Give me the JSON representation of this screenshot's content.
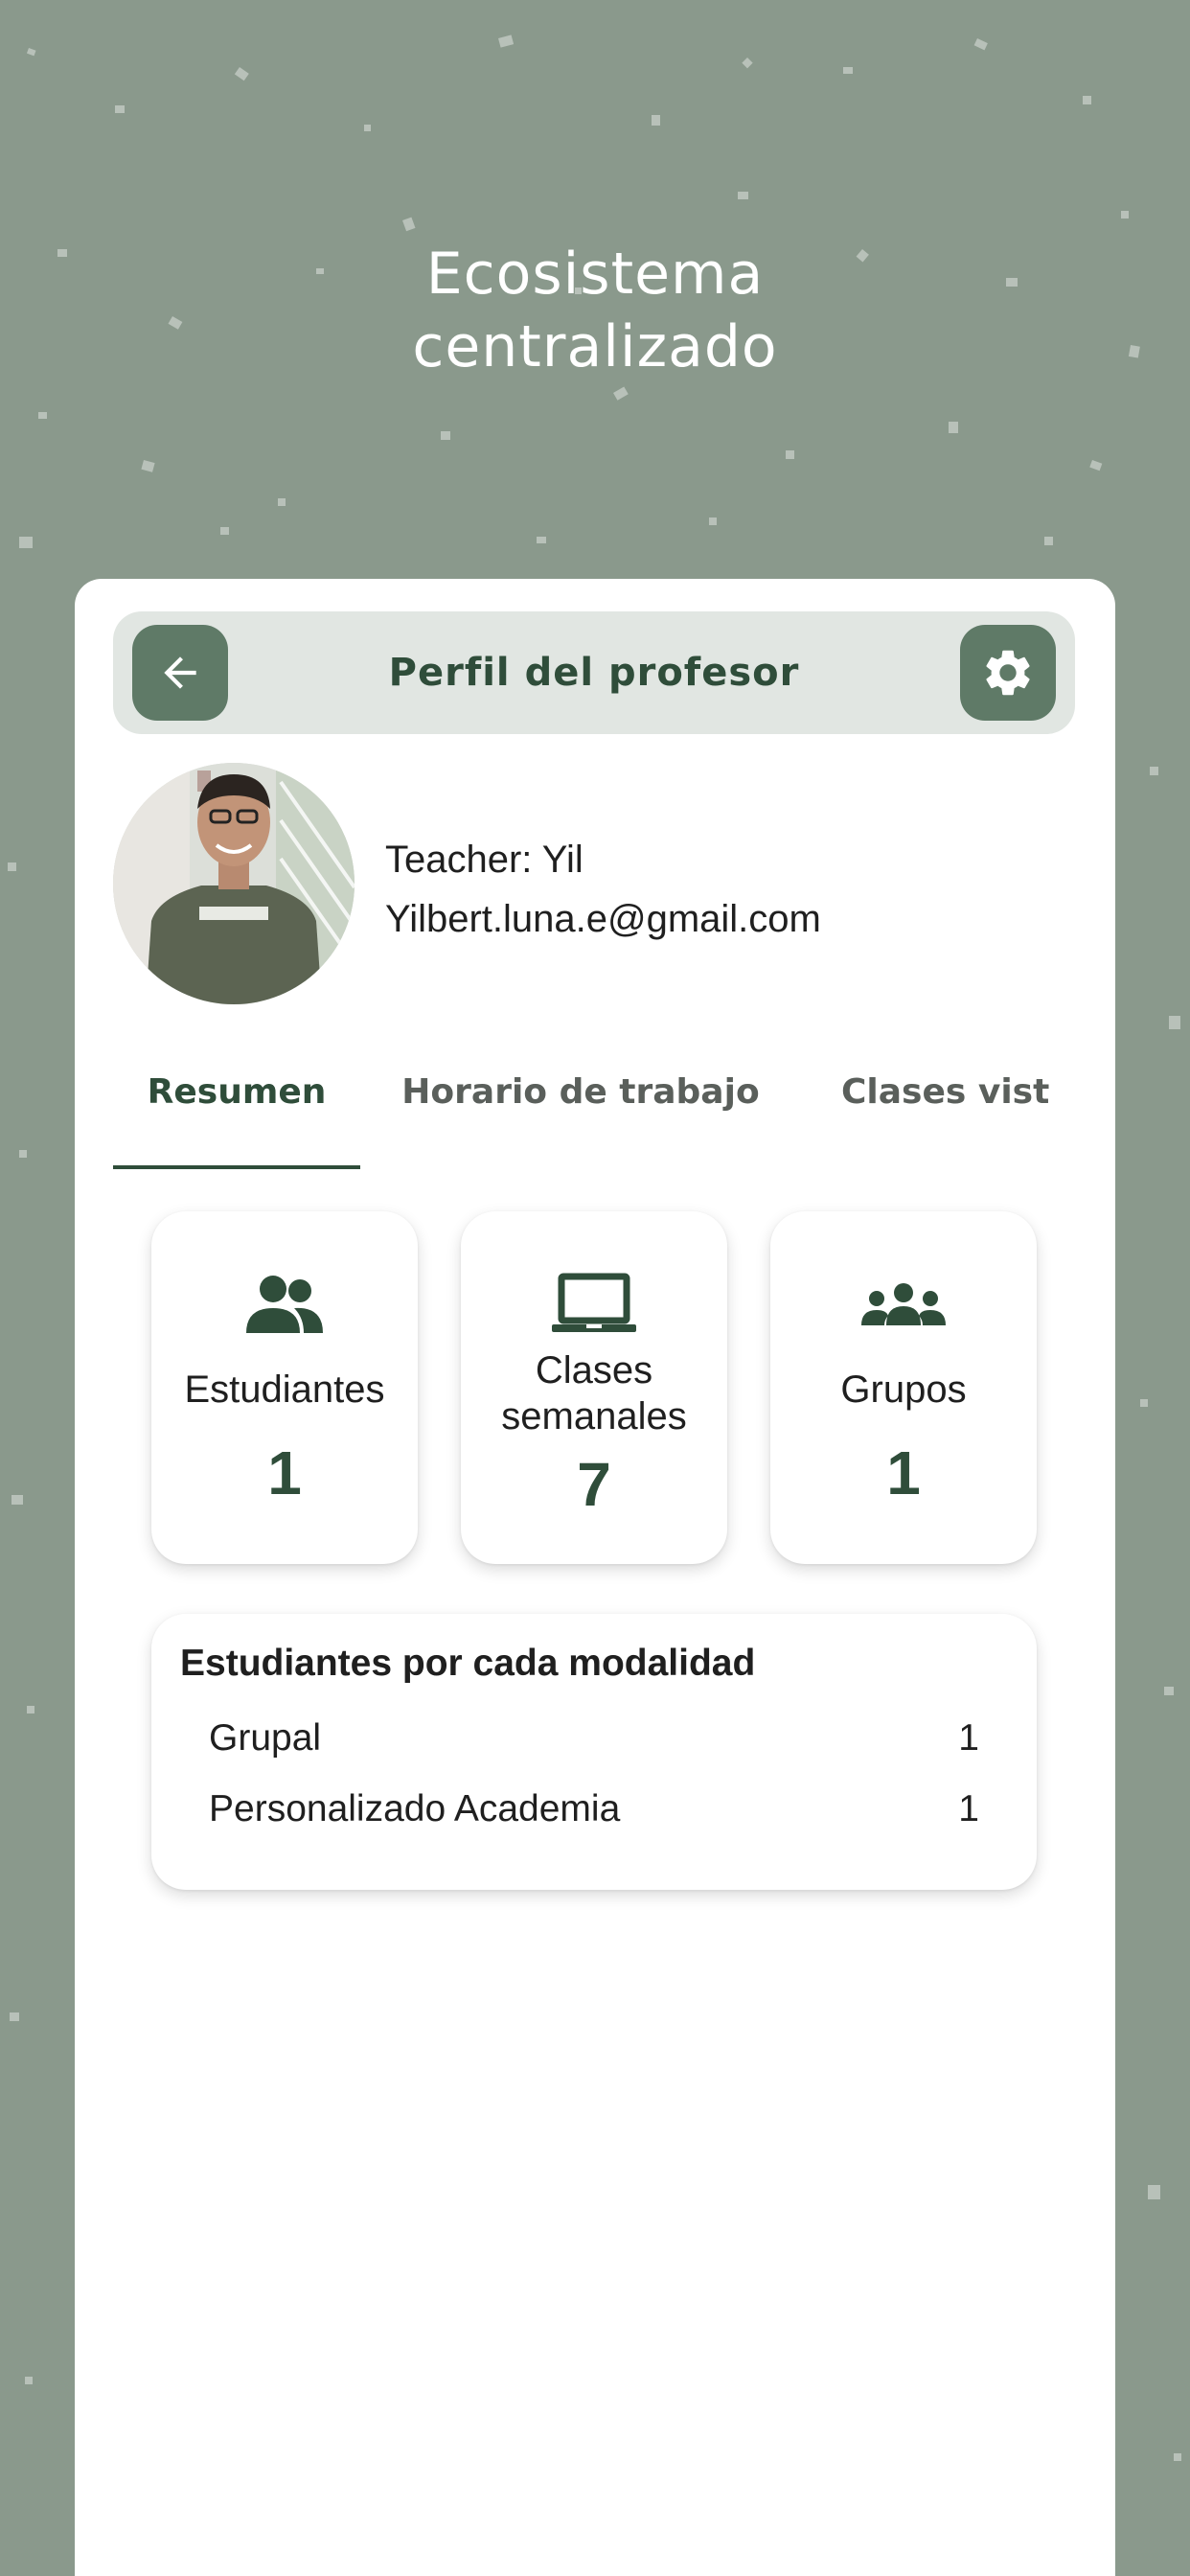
{
  "hero": {
    "line1": "Ecosistema",
    "line2": "centralizado"
  },
  "header": {
    "title": "Perfil del profesor",
    "back_icon": "arrow-left-icon",
    "settings_icon": "gear-icon"
  },
  "profile": {
    "teacher_label": "Teacher: Yil",
    "email": "Yilbert.luna.e@gmail.com"
  },
  "tabs": [
    {
      "label": "Resumen",
      "active": true
    },
    {
      "label": "Horario de trabajo",
      "active": false
    },
    {
      "label": "Clases vist",
      "active": false
    }
  ],
  "stats": [
    {
      "label": "Estudiantes",
      "value": "1",
      "icon": "students-icon"
    },
    {
      "label": "Clases semanales",
      "value": "7",
      "icon": "laptop-icon"
    },
    {
      "label": "Grupos",
      "value": "1",
      "icon": "groups-icon"
    }
  ],
  "modalities": {
    "title": "Estudiantes por cada modalidad",
    "rows": [
      {
        "name": "Grupal",
        "count": "1"
      },
      {
        "name": "Personalizado Academia",
        "count": "1"
      }
    ]
  },
  "colors": {
    "background": "#8a998c",
    "accent": "#2f4d3a",
    "button": "#5f7a67",
    "header_bar": "#e1e6e2"
  }
}
